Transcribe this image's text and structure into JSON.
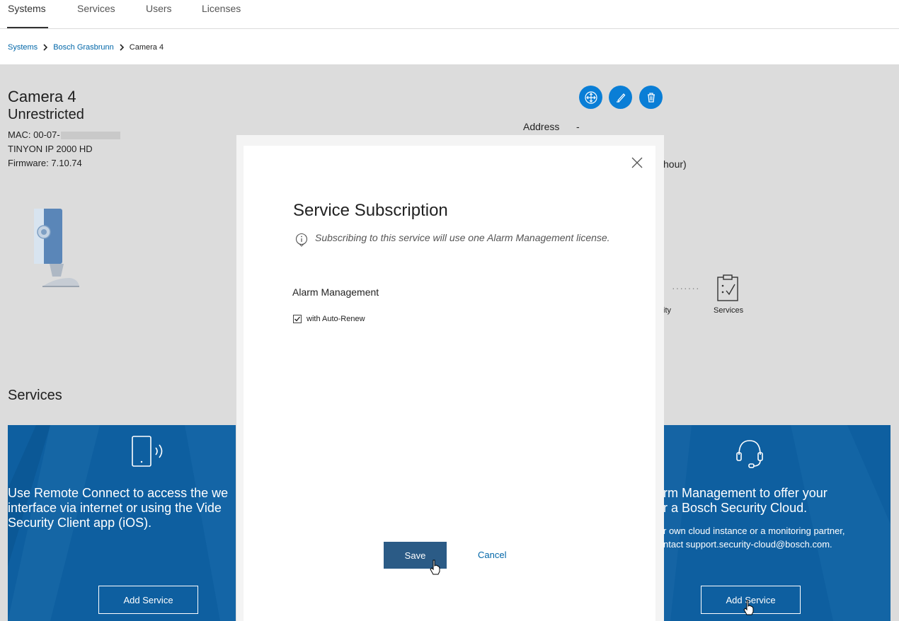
{
  "nav": {
    "tabs": [
      {
        "label": "Systems"
      },
      {
        "label": "Services"
      },
      {
        "label": "Users"
      },
      {
        "label": "Licenses"
      }
    ],
    "active_tab": "Systems"
  },
  "breadcrumb": {
    "items": [
      "Systems",
      "Bosch Grasbrunn",
      "Camera 4"
    ]
  },
  "device": {
    "name": "Camera 4",
    "status": "Unrestricted",
    "mac_prefix": "MAC: 00-07-",
    "model": "TINYON IP 2000 HD",
    "firmware": "Firmware: 7.10.74",
    "address_label": "Address",
    "address_value": "-",
    "partial_hour_text": "hour)",
    "partial_connectivity_label": "ity",
    "services_step_label": "Services",
    "actions": [
      "move-icon",
      "edit-icon",
      "delete-icon"
    ]
  },
  "services_section": {
    "title": "Services",
    "cards": [
      {
        "icon": "phone-signal-icon",
        "lines": [
          "Use Remote Connect to access the we",
          "interface via internet or using the Vide",
          "Security Client app (iOS)."
        ],
        "button": "Add Service"
      },
      {
        "icon": "headset-icon",
        "lines": [
          "rm Management to offer your",
          "r a Bosch Security Cloud."
        ],
        "small_lines": [
          "r own cloud instance or a monitoring partner,",
          "ntact support.security-cloud@bosch.com."
        ],
        "button": "Add Service"
      }
    ]
  },
  "modal": {
    "title": "Service Subscription",
    "info": "Subscribing to this service will use one Alarm Management license.",
    "service_name": "Alarm Management",
    "auto_renew_label": "with Auto-Renew",
    "auto_renew_checked": true,
    "save_label": "Save",
    "cancel_label": "Cancel"
  },
  "colors": {
    "accent": "#0a7ed6",
    "link": "#0066a8",
    "card_blue": "#0e5fa0",
    "save_button": "#2b5b86",
    "background_gray": "#dcdcdc"
  }
}
